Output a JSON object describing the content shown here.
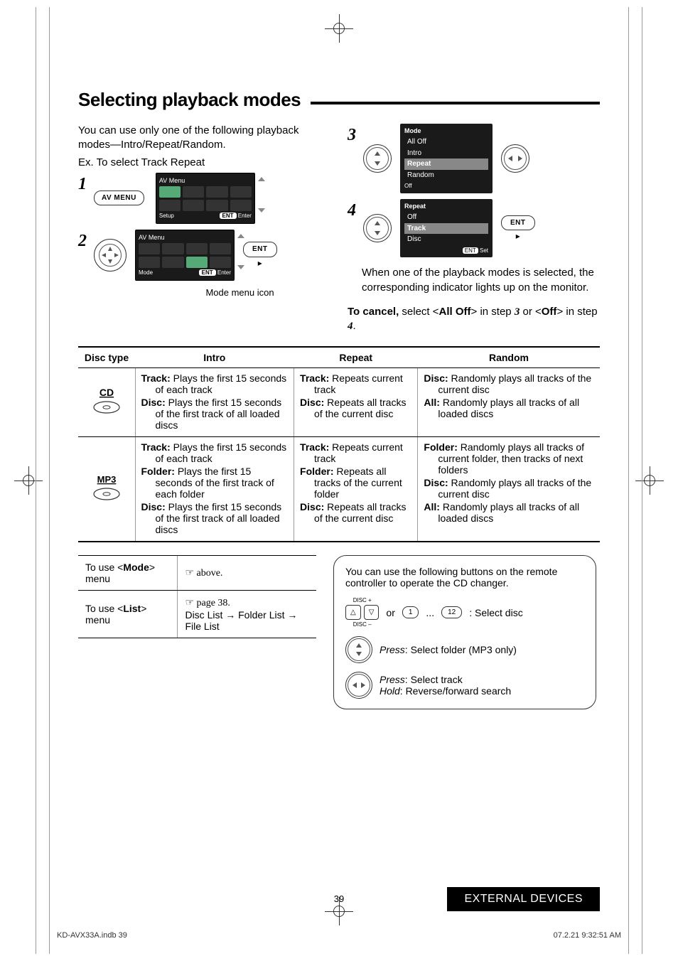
{
  "title": "Selecting playback modes",
  "intro_p1": "You can use only one of the following playback modes—Intro/Repeat/Random.",
  "intro_p2": "Ex. To select Track Repeat",
  "steps": {
    "s1": "1",
    "s2": "2",
    "s2_caption": "Mode menu icon",
    "s3": "3",
    "s4": "4"
  },
  "avmenu_btn": "AV MENU",
  "ent_btn": "ENT",
  "avmenu": {
    "title": "AV Menu",
    "foot_left_1": "Setup",
    "foot_left_2": "Mode",
    "foot_right_pill": "ENT",
    "foot_right_label": "Enter"
  },
  "mode_menu": {
    "title": "Mode",
    "items": [
      "All Off",
      "Intro",
      "Repeat",
      "Random"
    ],
    "foot_left": "Off"
  },
  "repeat_menu": {
    "title": "Repeat",
    "items": [
      "Off",
      "Track",
      "Disc"
    ],
    "foot_right_pill": "ENT",
    "foot_right_label": "Set"
  },
  "after_step4": "When one of the playback modes is selected, the corresponding indicator lights up on the monitor.",
  "cancel_prefix": "To cancel,",
  "cancel_mid1": " select <",
  "cancel_bold1": "All Off",
  "cancel_mid2": "> in step ",
  "cancel_step3": "3",
  "cancel_mid3": " or <",
  "cancel_bold2": "Off",
  "cancel_mid4": "> in step ",
  "cancel_step4": "4",
  "cancel_end": ".",
  "table_headers": {
    "c1": "Disc type",
    "c2": "Intro",
    "c3": "Repeat",
    "c4": "Random"
  },
  "row_cd": {
    "label": "CD",
    "intro": [
      {
        "b": "Track:",
        "t": " Plays the first 15 seconds of each track"
      },
      {
        "b": "Disc:",
        "t": " Plays the first 15 seconds of the first track of all loaded discs"
      }
    ],
    "repeat": [
      {
        "b": "Track:",
        "t": " Repeats current track"
      },
      {
        "b": "Disc:",
        "t": " Repeats all tracks of the current disc"
      }
    ],
    "random": [
      {
        "b": "Disc:",
        "t": " Randomly plays all tracks of the current disc"
      },
      {
        "b": "All:",
        "t": " Randomly plays all tracks of all loaded discs"
      }
    ]
  },
  "row_mp3": {
    "label": "MP3",
    "intro": [
      {
        "b": "Track:",
        "t": " Plays the first 15 seconds of each track"
      },
      {
        "b": "Folder:",
        "t": " Plays the first 15 seconds of the first track of each folder"
      },
      {
        "b": "Disc:",
        "t": " Plays the first 15 seconds of the first track of all loaded discs"
      }
    ],
    "repeat": [
      {
        "b": "Track:",
        "t": " Repeats current track"
      },
      {
        "b": "Folder:",
        "t": " Repeats all tracks of the current folder"
      },
      {
        "b": "Disc:",
        "t": " Repeats all tracks of the current disc"
      }
    ],
    "random": [
      {
        "b": "Folder:",
        "t": " Randomly plays all tracks of current folder, then tracks of next folders"
      },
      {
        "b": "Disc:",
        "t": " Randomly plays all tracks of the current disc"
      },
      {
        "b": "All:",
        "t": " Randomly plays all tracks of all loaded discs"
      }
    ]
  },
  "mini_table": {
    "r1_left_pre": "To use <",
    "r1_left_b": "Mode",
    "r1_left_post": "> menu",
    "r1_right": "☞ above.",
    "r2_left_pre": "To use <",
    "r2_left_b": "List",
    "r2_left_post": "> menu",
    "r2_right_l1": "☞ page 38.",
    "r2_right_l2": "Disc List → Folder List → File List"
  },
  "remote": {
    "intro": "You can use the following buttons on the remote controller to operate the CD changer.",
    "disc_plus": "DISC +",
    "disc_minus": "DISC –",
    "or": "or",
    "n1": "1",
    "dots": "...",
    "n12": "12",
    "select_disc": ": Select disc",
    "folder_press_i": "Press",
    "folder_press_t": ": Select folder (MP3 only)",
    "track_press_i": "Press",
    "track_press_t": ": Select track",
    "track_hold_i": "Hold",
    "track_hold_t": ": Reverse/forward search"
  },
  "page_number": "39",
  "footer_tab": "EXTERNAL DEVICES",
  "indb": "KD-AVX33A.indb   39",
  "timestamp": "07.2.21   9:32:51 AM"
}
